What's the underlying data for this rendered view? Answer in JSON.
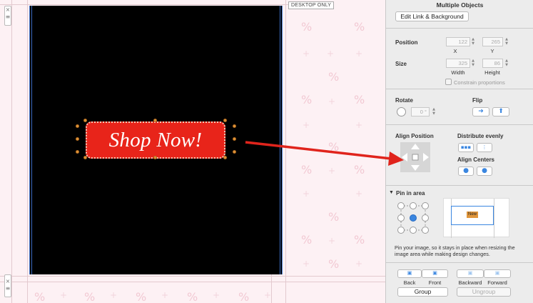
{
  "canvas": {
    "desktop_only_label": "DESKTOP ONLY",
    "button_text": "Shop Now!",
    "side_handle_top": [
      "×",
      "≡"
    ],
    "side_handle_bottom": [
      "×",
      "≡"
    ]
  },
  "panel": {
    "title": "Multiple Objects",
    "edit_link_label": "Edit Link & Background",
    "position": {
      "label": "Position",
      "x": "122",
      "y": "265",
      "x_label": "X",
      "y_label": "Y"
    },
    "size": {
      "label": "Size",
      "width": "325",
      "height": "86",
      "width_label": "Width",
      "height_label": "Height",
      "constrain_label": "Constrain proportions"
    },
    "rotate": {
      "label": "Rotate",
      "value": "0 °"
    },
    "flip": {
      "label": "Flip"
    },
    "align_position_label": "Align Position",
    "distribute_label": "Distribute evenly",
    "align_centers_label": "Align Centers",
    "pin": {
      "label": "Pin in area",
      "preview_badge": "New",
      "help": "Pin your image, so it stays in place when resizing the image area while making design changes."
    },
    "arrange": {
      "back": "Back",
      "front": "Front",
      "backward": "Backward",
      "forward": "Forward",
      "group": "Group",
      "ungroup": "Ungroup"
    }
  },
  "colors": {
    "accent": "#3a86e0",
    "button_red": "#e8241a",
    "arrow_red": "#e0241c"
  }
}
